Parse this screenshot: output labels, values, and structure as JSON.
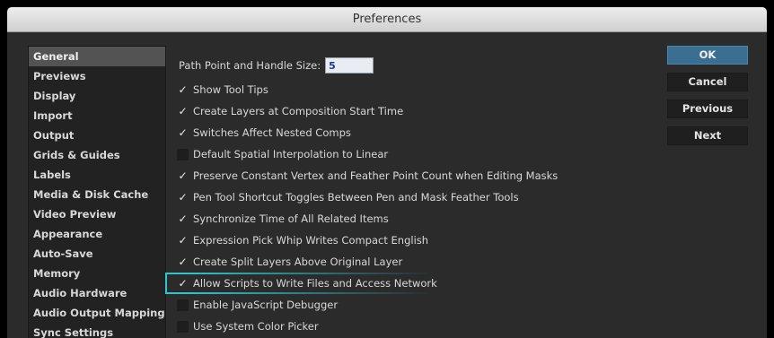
{
  "window": {
    "title": "Preferences"
  },
  "sidebar": {
    "items": [
      {
        "label": "General",
        "selected": true
      },
      {
        "label": "Previews"
      },
      {
        "label": "Display"
      },
      {
        "label": "Import"
      },
      {
        "label": "Output"
      },
      {
        "label": "Grids & Guides"
      },
      {
        "label": "Labels"
      },
      {
        "label": "Media & Disk Cache"
      },
      {
        "label": "Video Preview"
      },
      {
        "label": "Appearance"
      },
      {
        "label": "Auto-Save"
      },
      {
        "label": "Memory"
      },
      {
        "label": "Audio Hardware"
      },
      {
        "label": "Audio Output Mapping"
      },
      {
        "label": "Sync Settings"
      }
    ]
  },
  "general": {
    "path_point_label": "Path Point and Handle Size:",
    "path_point_value": "5",
    "checkmark_glyph": "✓",
    "options": [
      {
        "label": "Show Tool Tips",
        "checked": true
      },
      {
        "label": "Create Layers at Composition Start Time",
        "checked": true
      },
      {
        "label": "Switches Affect Nested Comps",
        "checked": true
      },
      {
        "label": "Default Spatial Interpolation to Linear",
        "checked": false
      },
      {
        "label": "Preserve Constant Vertex and Feather Point Count when Editing Masks",
        "checked": true
      },
      {
        "label": "Pen Tool Shortcut Toggles Between Pen and Mask Feather Tools",
        "checked": true
      },
      {
        "label": "Synchronize Time of All Related Items",
        "checked": true
      },
      {
        "label": "Expression Pick Whip Writes Compact English",
        "checked": true
      },
      {
        "label": "Create Split Layers Above Original Layer",
        "checked": true
      },
      {
        "label": "Allow Scripts to Write Files and Access Network",
        "checked": true,
        "highlighted": true
      },
      {
        "label": "Enable JavaScript Debugger",
        "checked": false
      },
      {
        "label": "Use System Color Picker",
        "checked": false
      }
    ]
  },
  "buttons": {
    "ok": "OK",
    "cancel": "Cancel",
    "previous": "Previous",
    "next": "Next"
  },
  "colors": {
    "accent_button": "#3b6f92",
    "highlight_outline": "#2ec6cf",
    "panel_bg": "#2b2b2b"
  }
}
